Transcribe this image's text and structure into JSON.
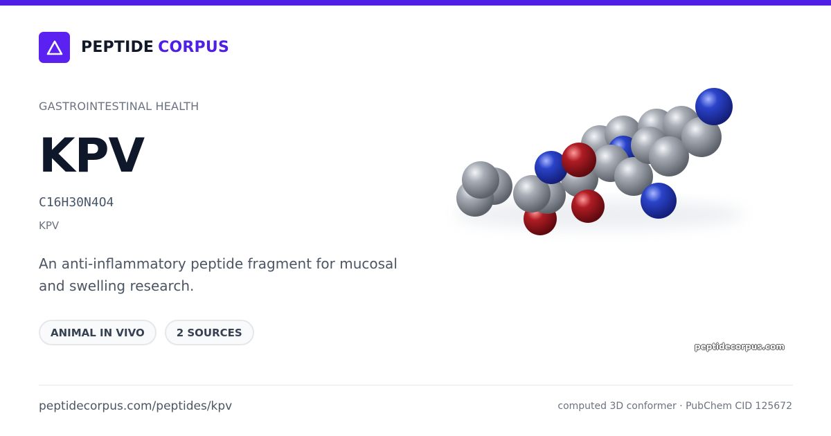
{
  "theme": {
    "accent": "#4f1fe6",
    "logo_bg": "#5b21f0"
  },
  "brand": {
    "word1": "PEPTIDE",
    "word2": "CORPUS",
    "logo_icon": "triangle-icon"
  },
  "peptide": {
    "category": "GASTROINTESTINAL HEALTH",
    "name": "KPV",
    "formula": "C16H30N4O4",
    "sequence": "KPV",
    "description": "An anti-inflammatory peptide fragment for mucosal and swelling research."
  },
  "tags": [
    {
      "label": "ANIMAL IN VIVO"
    },
    {
      "label": "2 SOURCES"
    }
  ],
  "molecule": {
    "atom_colors": {
      "C": "#8a9099",
      "N": "#2238b8",
      "O": "#a0151c"
    }
  },
  "watermark": "peptidecorpus.com",
  "footer": {
    "url": "peptidecorpus.com/peptides/kpv",
    "source": "computed 3D conformer · PubChem CID 125672"
  }
}
